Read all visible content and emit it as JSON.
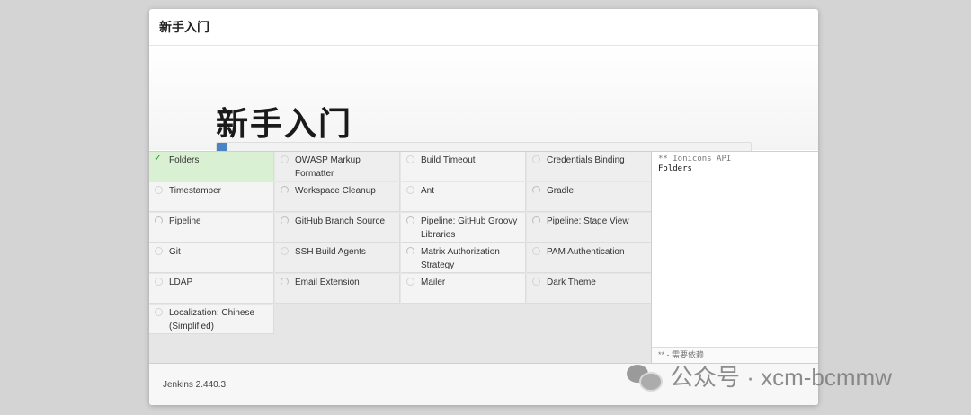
{
  "header": {
    "title": "新手入门"
  },
  "hero": {
    "title": "新手入门"
  },
  "progress": {
    "fraction": 0.02
  },
  "plugins": [
    [
      {
        "label": "Folders",
        "status": "done"
      },
      {
        "label": "Timestamper",
        "status": "pending"
      },
      {
        "label": "Pipeline",
        "status": "installing"
      },
      {
        "label": "Git",
        "status": "pending"
      },
      {
        "label": "LDAP",
        "status": "pending"
      },
      {
        "label": "Localization: Chinese (Simplified)",
        "status": "pending"
      }
    ],
    [
      {
        "label": "OWASP Markup Formatter",
        "status": "pending"
      },
      {
        "label": "Workspace Cleanup",
        "status": "installing"
      },
      {
        "label": "GitHub Branch Source",
        "status": "installing"
      },
      {
        "label": "SSH Build Agents",
        "status": "pending"
      },
      {
        "label": "Email Extension",
        "status": "installing"
      }
    ],
    [
      {
        "label": "Build Timeout",
        "status": "pending"
      },
      {
        "label": "Ant",
        "status": "pending"
      },
      {
        "label": "Pipeline: GitHub Groovy Libraries",
        "status": "installing"
      },
      {
        "label": "Matrix Authorization Strategy",
        "status": "installing"
      },
      {
        "label": "Mailer",
        "status": "pending"
      }
    ],
    [
      {
        "label": "Credentials Binding",
        "status": "pending"
      },
      {
        "label": "Gradle",
        "status": "installing"
      },
      {
        "label": "Pipeline: Stage View",
        "status": "installing"
      },
      {
        "label": "PAM Authentication",
        "status": "pending"
      },
      {
        "label": "Dark Theme",
        "status": "pending"
      }
    ]
  ],
  "log": {
    "lines": [
      "** Ionicons API",
      "Folders"
    ],
    "legend": "** - 需要依赖"
  },
  "footer": {
    "version": "Jenkins 2.440.3"
  },
  "watermark": {
    "text": "公众号 · xcm-bcmmw"
  },
  "colors": {
    "accent": "#4a84c4",
    "done": "#d9f0d3"
  }
}
